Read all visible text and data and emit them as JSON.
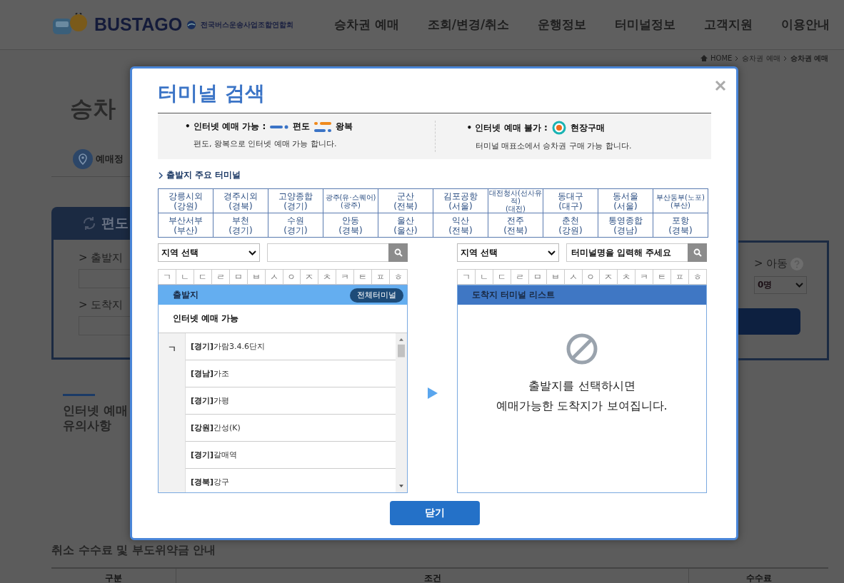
{
  "header": {
    "logo": "BUSTAGO",
    "association": "전국버스운송사업조합연합회",
    "nav": [
      "승차권 예매",
      "조회/변경/취소",
      "운행정보",
      "터미널정보",
      "고객지원",
      "이용안내"
    ]
  },
  "breadcrumb": [
    "HOME",
    "승차권 예매",
    "승차권 예매"
  ],
  "page": {
    "title": "승차",
    "tab": "예매정",
    "trip_type": "편도",
    "origin_label": "> 출발지",
    "destination_label": "> 도착지",
    "child_label": "> 아동",
    "child_count": "0명",
    "notice_title": [
      "인터넷 예매",
      "유의사항"
    ]
  },
  "fees": {
    "title": "취소 수수료 및 부도위약금 안내",
    "columns": [
      "구분",
      "조건",
      "수수료"
    ]
  },
  "modal": {
    "title": "터미널 검색",
    "legend": [
      {
        "label": "• 인터넷 예매 가능 :",
        "types": [
          {
            "kind": "one_way",
            "label": "편도"
          },
          {
            "kind": "round_trip",
            "label": "왕복"
          }
        ],
        "description": "편도, 왕복으로 인터넷 예매 가능 합니다."
      },
      {
        "label": "• 인터넷 예매 불가 :",
        "types": [
          {
            "kind": "onsite",
            "label": "현장구매"
          }
        ],
        "description": "터미널 매표소에서 승차권 구매 가능 합니다."
      }
    ],
    "major_title": "출발지 주요 터미널",
    "major_terminals": [
      {
        "name": "강릉시외",
        "region": "(강원)",
        "small": false
      },
      {
        "name": "경주시외",
        "region": "(경북)",
        "small": false
      },
      {
        "name": "고양종합",
        "region": "(경기)",
        "small": false
      },
      {
        "name": "광주(유·스퀘어)",
        "region": "(광주)",
        "small": true
      },
      {
        "name": "군산",
        "region": "(전북)",
        "small": false
      },
      {
        "name": "김포공항",
        "region": "(서울)",
        "small": false
      },
      {
        "name": "대전청사(선사유적)",
        "region": "(대전)",
        "small": true
      },
      {
        "name": "동대구",
        "region": "(대구)",
        "small": false
      },
      {
        "name": "동서울",
        "region": "(서울)",
        "small": false
      },
      {
        "name": "부산동부(노포)",
        "region": "(부산)",
        "small": true
      },
      {
        "name": "부산서부",
        "region": "(부산)",
        "small": false
      },
      {
        "name": "부천",
        "region": "(경기)",
        "small": false
      },
      {
        "name": "수원",
        "region": "(경기)",
        "small": false
      },
      {
        "name": "안동",
        "region": "(경북)",
        "small": false
      },
      {
        "name": "울산",
        "region": "(울산)",
        "small": false
      },
      {
        "name": "익산",
        "region": "(전북)",
        "small": false
      },
      {
        "name": "전주",
        "region": "(전북)",
        "small": false
      },
      {
        "name": "춘천",
        "region": "(강원)",
        "small": false
      },
      {
        "name": "통영종합",
        "region": "(경남)",
        "small": false
      },
      {
        "name": "포항",
        "region": "(경북)",
        "small": false
      }
    ],
    "departure": {
      "region_select": "지역 선택",
      "consonants": [
        "ㄱ",
        "ㄴ",
        "ㄷ",
        "ㄹ",
        "ㅁ",
        "ㅂ",
        "ㅅ",
        "ㅇ",
        "ㅈ",
        "ㅊ",
        "ㅋ",
        "ㅌ",
        "ㅍ",
        "ㅎ"
      ],
      "header": "출발지",
      "all_button": "전체터미널",
      "group_title": "인터넷 예매 가능",
      "index": "ㄱ",
      "items": [
        {
          "label": "**[경기]**가람3.4.6단지"
        },
        {
          "label": "**[경남]**가조"
        },
        {
          "label": "**[경기]**가평"
        },
        {
          "label": "**[강원]**간성(K)"
        },
        {
          "label": "**[경기]**갈매역"
        },
        {
          "label": "**[경북]**강구"
        }
      ]
    },
    "arrival": {
      "region_select": "지역 선택",
      "search_placeholder": "터미널명을 입력해 주세요",
      "consonants": [
        "ㄱ",
        "ㄴ",
        "ㄷ",
        "ㄹ",
        "ㅁ",
        "ㅂ",
        "ㅅ",
        "ㅇ",
        "ㅈ",
        "ㅊ",
        "ㅋ",
        "ㅌ",
        "ㅍ",
        "ㅎ"
      ],
      "header": "도착지 터미널 리스트",
      "empty_message": [
        "출발지를 선택하시면",
        "예매가능한 도착지가 보여집니다."
      ]
    },
    "close_button": "닫기"
  }
}
